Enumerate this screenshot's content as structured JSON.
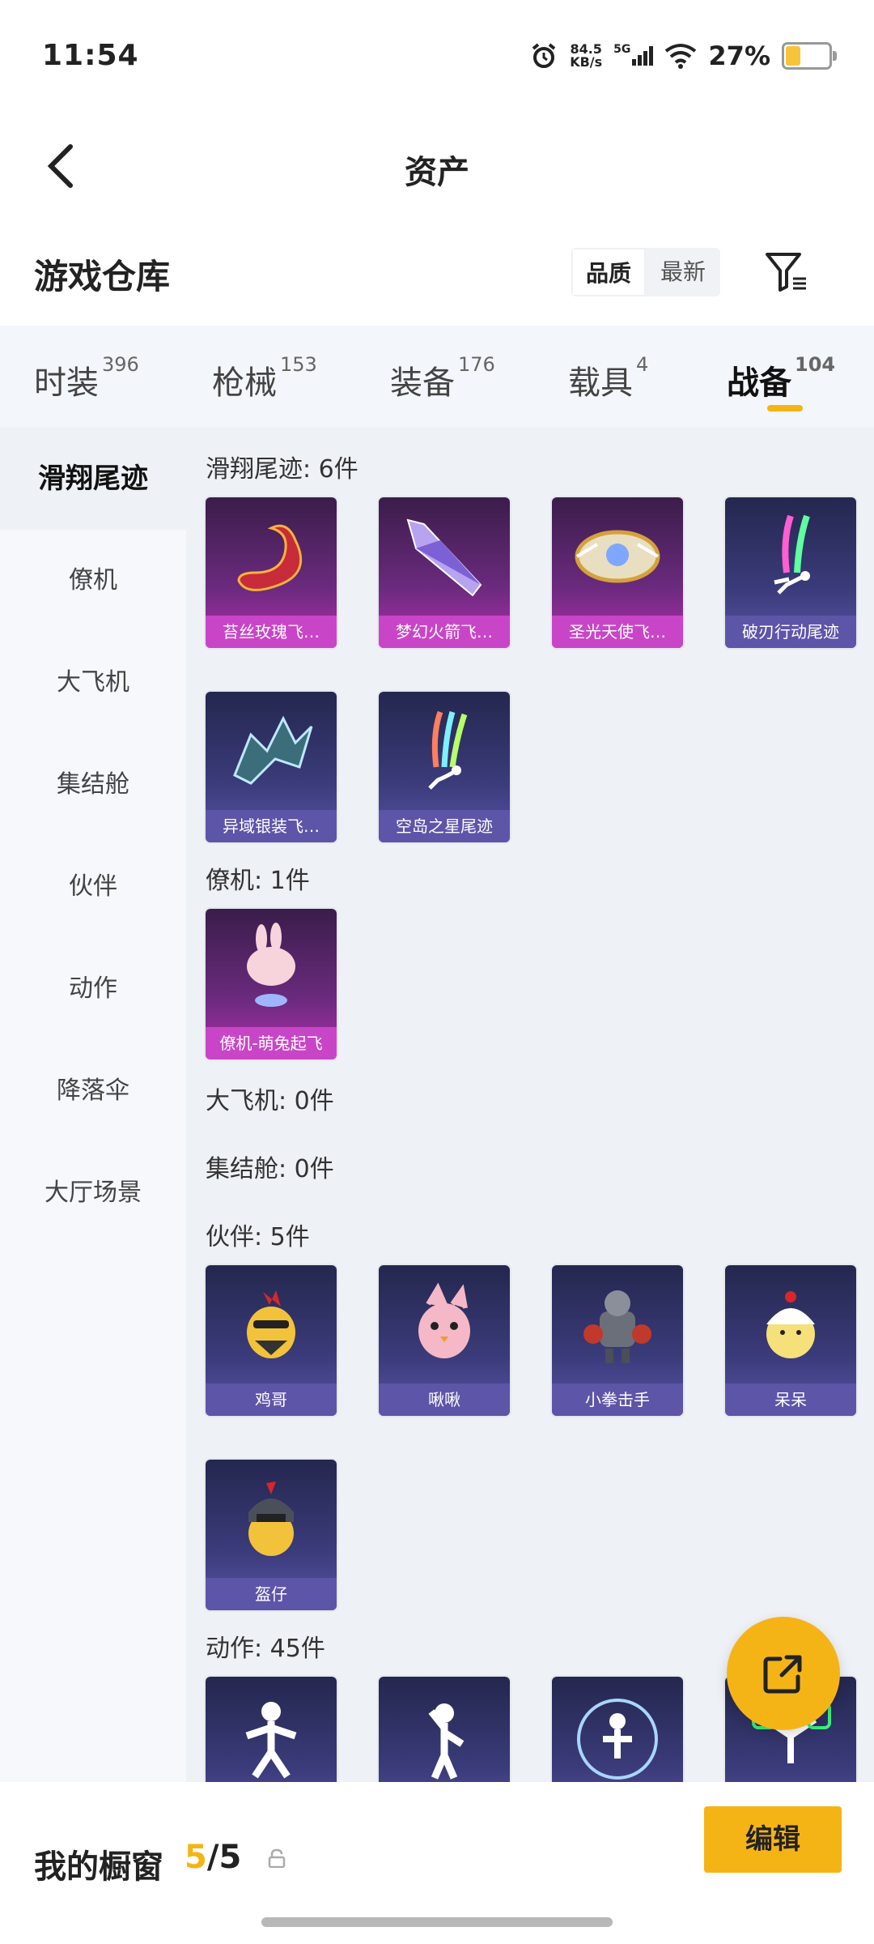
{
  "status_bar": {
    "time": "11:54",
    "net_speed": "84.5",
    "net_unit": "KB/s",
    "signal": "5G",
    "battery": "27%"
  },
  "header": {
    "title": "资产"
  },
  "section": {
    "name": "游戏仓库",
    "sort_options": [
      "品质",
      "最新"
    ]
  },
  "tabs": [
    {
      "label": "时装",
      "count": "396"
    },
    {
      "label": "枪械",
      "count": "153"
    },
    {
      "label": "装备",
      "count": "176"
    },
    {
      "label": "载具",
      "count": "4"
    },
    {
      "label": "战备",
      "count": "104"
    }
  ],
  "sidebar": [
    "滑翔尾迹",
    "僚机",
    "大飞机",
    "集结舱",
    "伙伴",
    "动作",
    "降落伞",
    "大厅场景"
  ],
  "groups": {
    "glide": {
      "label": "滑翔尾迹: 6件",
      "items": [
        "苔丝玫瑰飞…",
        "梦幻火箭飞…",
        "圣光天使飞…",
        "破刃行动尾迹",
        "异域银装飞…",
        "空岛之星尾迹"
      ]
    },
    "wingman": {
      "label": "僚机: 1件",
      "items": [
        "僚机-萌兔起飞"
      ]
    },
    "plane": {
      "label": "大飞机: 0件"
    },
    "pod": {
      "label": "集结舱: 0件"
    },
    "partner": {
      "label": "伙伴: 5件",
      "items": [
        "鸡哥",
        "啾啾",
        "小拳击手",
        "呆呆",
        "盔仔"
      ]
    },
    "action": {
      "label": "动作: 45件"
    }
  },
  "bottom": {
    "label": "我的橱窗",
    "used": "5",
    "total": "/5",
    "edit": "编辑"
  },
  "icons": [
    "back-icon",
    "filter-icon",
    "alarm-icon",
    "signal-icon",
    "wifi-icon",
    "battery-icon",
    "share-icon",
    "lock-icon"
  ]
}
